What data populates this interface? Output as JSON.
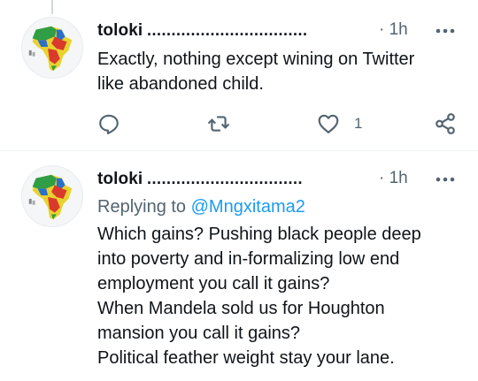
{
  "tweets": [
    {
      "name": "toloki",
      "dots": ".................................",
      "time": "· 1h",
      "text": "Exactly, nothing except wining on Twitter\nlike abandoned child.",
      "like_count": "1"
    },
    {
      "name": "toloki",
      "dots": "................................",
      "time": "· 1h",
      "replying_prefix": "Replying to ",
      "replying_handle": "@Mngxitama2",
      "text": "Which gains? Pushing black people deep\ninto poverty and in-formalizing low end\nemployment you call it gains?\nWhen Mandela sold us for Houghton\nmansion you call it gains?\nPolitical feather weight stay your lane."
    }
  ],
  "colors": {
    "text": "#0f1419",
    "secondary": "#536471",
    "link": "#1d9bf0",
    "icon": "#536471"
  },
  "icons": {
    "reply": "reply-icon",
    "retweet": "retweet-icon",
    "like": "heart-icon",
    "share": "share-icon",
    "more": "more-icon"
  }
}
